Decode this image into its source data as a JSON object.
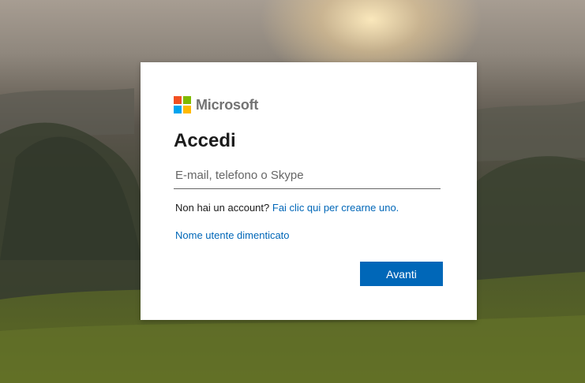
{
  "brand": {
    "name": "Microsoft",
    "logo_colors": [
      "#f25022",
      "#7fba00",
      "#00a4ef",
      "#ffb900"
    ]
  },
  "signin": {
    "title": "Accedi",
    "email_placeholder": "E-mail, telefono o Skype",
    "email_value": "",
    "no_account_text": "Non hai un account?",
    "create_account_link": "Fai clic qui per crearne uno.",
    "forgot_username_link": "Nome utente dimenticato",
    "next_button": "Avanti"
  },
  "colors": {
    "link": "#0067b8",
    "primary_button": "#0067b8"
  }
}
